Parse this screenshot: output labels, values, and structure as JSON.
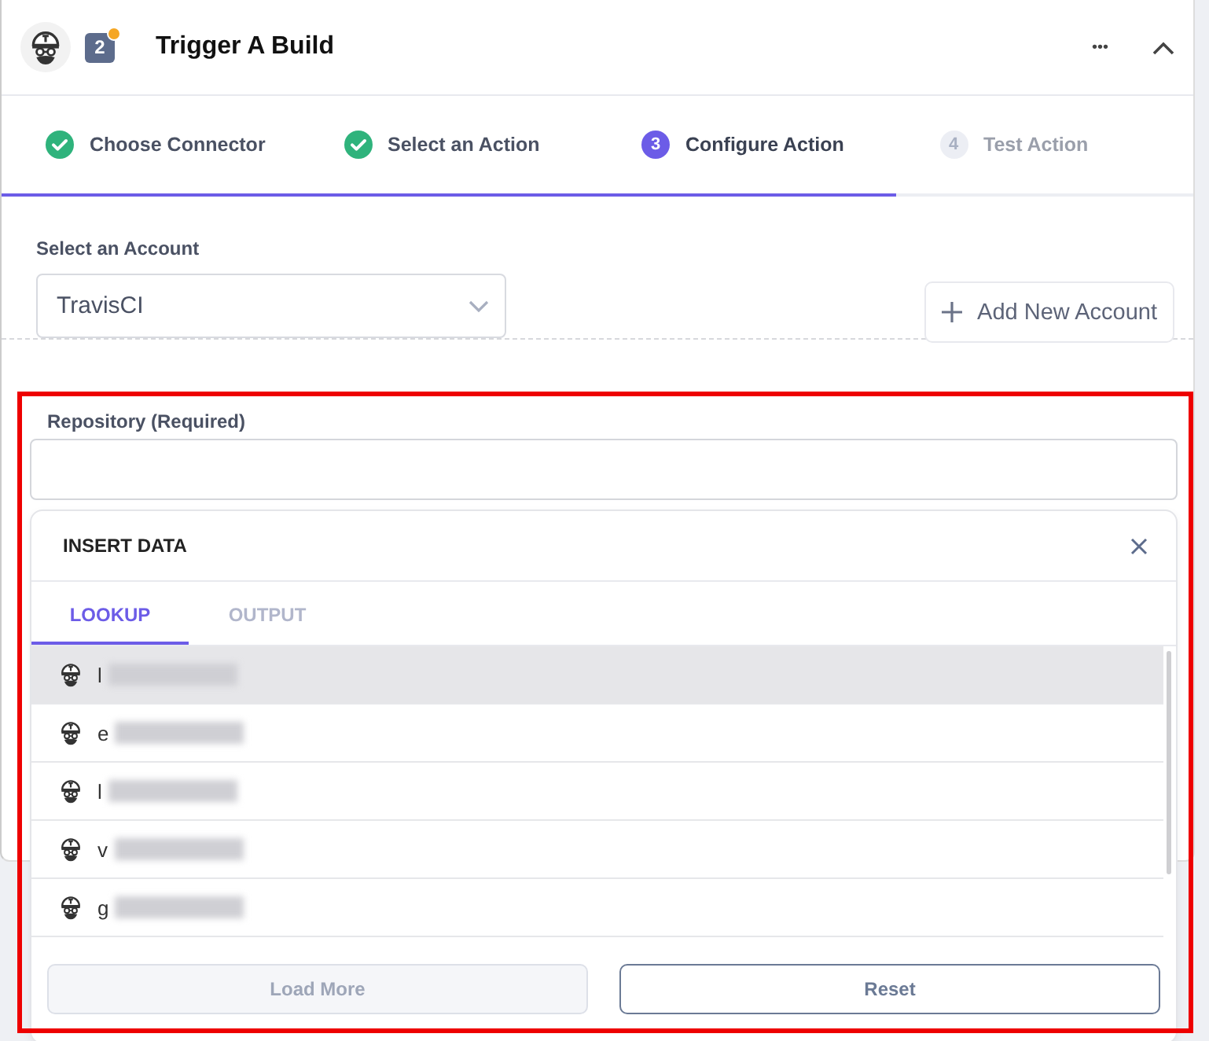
{
  "header": {
    "title": "Trigger A Build",
    "step_badge": "2",
    "badge_alert": true,
    "more_icon": "•••",
    "collapsed": false
  },
  "steps": [
    {
      "label": "Choose Connector",
      "completed": true,
      "selected": false
    },
    {
      "label": "Select an Action",
      "completed": true,
      "selected": false
    },
    {
      "number": "3",
      "label": "Configure Action",
      "completed": false,
      "selected": true
    },
    {
      "number": "4",
      "label": "Test Action",
      "completed": false,
      "selected": false
    }
  ],
  "progress": {
    "level": 0.75
  },
  "account": {
    "label": "Select an Account",
    "value": "TravisCI",
    "add_button": "Add New Account"
  },
  "repository": {
    "label": "Repository (Required)",
    "highlighted": true
  },
  "insert_data": {
    "title": "INSERT DATA",
    "tabs": [
      {
        "label": "LOOKUP",
        "selected": true
      },
      {
        "label": "OUTPUT",
        "selected": false
      }
    ],
    "items": [
      {
        "text": "l",
        "redacted": true,
        "selected": true
      },
      {
        "text": "e",
        "redacted": true,
        "selected": false
      },
      {
        "text": "l",
        "redacted": true,
        "selected": false
      },
      {
        "text": "v",
        "redacted": true,
        "selected": false
      },
      {
        "text": "g",
        "redacted": true,
        "selected": false
      }
    ],
    "buttons": [
      {
        "label": "Load More",
        "disabled": true
      },
      {
        "label": "Reset",
        "disabled": false
      }
    ]
  }
}
